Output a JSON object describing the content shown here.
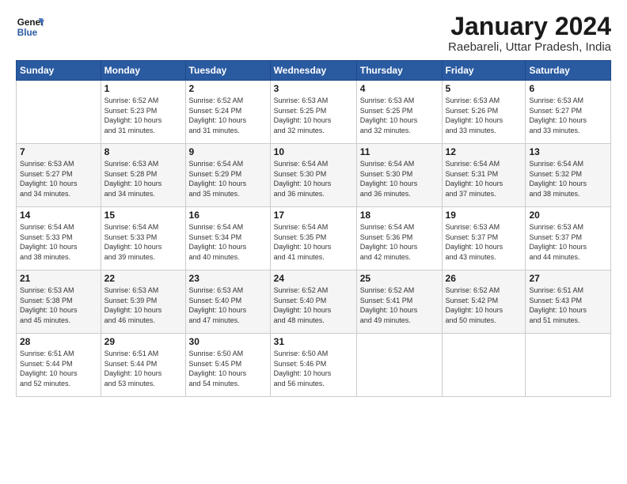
{
  "logo": {
    "line1": "General",
    "line2": "Blue"
  },
  "title": "January 2024",
  "location": "Raebareli, Uttar Pradesh, India",
  "days_header": [
    "Sunday",
    "Monday",
    "Tuesday",
    "Wednesday",
    "Thursday",
    "Friday",
    "Saturday"
  ],
  "weeks": [
    [
      {
        "day": "",
        "info": ""
      },
      {
        "day": "1",
        "info": "Sunrise: 6:52 AM\nSunset: 5:23 PM\nDaylight: 10 hours\nand 31 minutes."
      },
      {
        "day": "2",
        "info": "Sunrise: 6:52 AM\nSunset: 5:24 PM\nDaylight: 10 hours\nand 31 minutes."
      },
      {
        "day": "3",
        "info": "Sunrise: 6:53 AM\nSunset: 5:25 PM\nDaylight: 10 hours\nand 32 minutes."
      },
      {
        "day": "4",
        "info": "Sunrise: 6:53 AM\nSunset: 5:25 PM\nDaylight: 10 hours\nand 32 minutes."
      },
      {
        "day": "5",
        "info": "Sunrise: 6:53 AM\nSunset: 5:26 PM\nDaylight: 10 hours\nand 33 minutes."
      },
      {
        "day": "6",
        "info": "Sunrise: 6:53 AM\nSunset: 5:27 PM\nDaylight: 10 hours\nand 33 minutes."
      }
    ],
    [
      {
        "day": "7",
        "info": "Sunrise: 6:53 AM\nSunset: 5:27 PM\nDaylight: 10 hours\nand 34 minutes."
      },
      {
        "day": "8",
        "info": "Sunrise: 6:53 AM\nSunset: 5:28 PM\nDaylight: 10 hours\nand 34 minutes."
      },
      {
        "day": "9",
        "info": "Sunrise: 6:54 AM\nSunset: 5:29 PM\nDaylight: 10 hours\nand 35 minutes."
      },
      {
        "day": "10",
        "info": "Sunrise: 6:54 AM\nSunset: 5:30 PM\nDaylight: 10 hours\nand 36 minutes."
      },
      {
        "day": "11",
        "info": "Sunrise: 6:54 AM\nSunset: 5:30 PM\nDaylight: 10 hours\nand 36 minutes."
      },
      {
        "day": "12",
        "info": "Sunrise: 6:54 AM\nSunset: 5:31 PM\nDaylight: 10 hours\nand 37 minutes."
      },
      {
        "day": "13",
        "info": "Sunrise: 6:54 AM\nSunset: 5:32 PM\nDaylight: 10 hours\nand 38 minutes."
      }
    ],
    [
      {
        "day": "14",
        "info": "Sunrise: 6:54 AM\nSunset: 5:33 PM\nDaylight: 10 hours\nand 38 minutes."
      },
      {
        "day": "15",
        "info": "Sunrise: 6:54 AM\nSunset: 5:33 PM\nDaylight: 10 hours\nand 39 minutes."
      },
      {
        "day": "16",
        "info": "Sunrise: 6:54 AM\nSunset: 5:34 PM\nDaylight: 10 hours\nand 40 minutes."
      },
      {
        "day": "17",
        "info": "Sunrise: 6:54 AM\nSunset: 5:35 PM\nDaylight: 10 hours\nand 41 minutes."
      },
      {
        "day": "18",
        "info": "Sunrise: 6:54 AM\nSunset: 5:36 PM\nDaylight: 10 hours\nand 42 minutes."
      },
      {
        "day": "19",
        "info": "Sunrise: 6:53 AM\nSunset: 5:37 PM\nDaylight: 10 hours\nand 43 minutes."
      },
      {
        "day": "20",
        "info": "Sunrise: 6:53 AM\nSunset: 5:37 PM\nDaylight: 10 hours\nand 44 minutes."
      }
    ],
    [
      {
        "day": "21",
        "info": "Sunrise: 6:53 AM\nSunset: 5:38 PM\nDaylight: 10 hours\nand 45 minutes."
      },
      {
        "day": "22",
        "info": "Sunrise: 6:53 AM\nSunset: 5:39 PM\nDaylight: 10 hours\nand 46 minutes."
      },
      {
        "day": "23",
        "info": "Sunrise: 6:53 AM\nSunset: 5:40 PM\nDaylight: 10 hours\nand 47 minutes."
      },
      {
        "day": "24",
        "info": "Sunrise: 6:52 AM\nSunset: 5:40 PM\nDaylight: 10 hours\nand 48 minutes."
      },
      {
        "day": "25",
        "info": "Sunrise: 6:52 AM\nSunset: 5:41 PM\nDaylight: 10 hours\nand 49 minutes."
      },
      {
        "day": "26",
        "info": "Sunrise: 6:52 AM\nSunset: 5:42 PM\nDaylight: 10 hours\nand 50 minutes."
      },
      {
        "day": "27",
        "info": "Sunrise: 6:51 AM\nSunset: 5:43 PM\nDaylight: 10 hours\nand 51 minutes."
      }
    ],
    [
      {
        "day": "28",
        "info": "Sunrise: 6:51 AM\nSunset: 5:44 PM\nDaylight: 10 hours\nand 52 minutes."
      },
      {
        "day": "29",
        "info": "Sunrise: 6:51 AM\nSunset: 5:44 PM\nDaylight: 10 hours\nand 53 minutes."
      },
      {
        "day": "30",
        "info": "Sunrise: 6:50 AM\nSunset: 5:45 PM\nDaylight: 10 hours\nand 54 minutes."
      },
      {
        "day": "31",
        "info": "Sunrise: 6:50 AM\nSunset: 5:46 PM\nDaylight: 10 hours\nand 56 minutes."
      },
      {
        "day": "",
        "info": ""
      },
      {
        "day": "",
        "info": ""
      },
      {
        "day": "",
        "info": ""
      }
    ]
  ]
}
